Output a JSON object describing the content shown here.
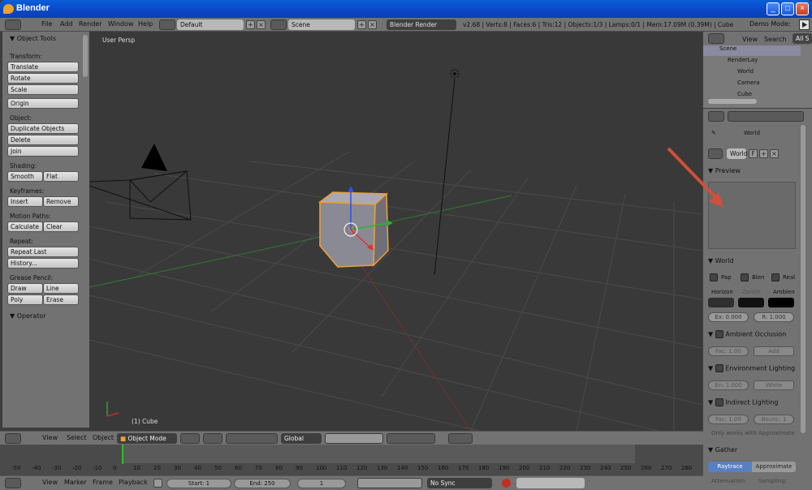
{
  "window": {
    "title": "Blender",
    "controls": [
      "_",
      "□",
      "×"
    ]
  },
  "infobar": {
    "menus": [
      "File",
      "Add",
      "Render",
      "Window",
      "Help"
    ],
    "layout": "Default",
    "scene": "Scene",
    "engine": "Blender Render",
    "stats": "v2.68 | Verts:8 | Faces:6 | Tris:12 | Objects:1/3 | Lamps:0/1 | Mem:17.09M (0.39M) | Cube",
    "demo_label": "Demo Mode:"
  },
  "toolshelf": {
    "title": "Object Tools",
    "sections": {
      "transform": "Transform:",
      "object": "Object:",
      "shading": "Shading:",
      "keyframes": "Keyframes:",
      "motion_paths": "Motion Paths:",
      "repeat": "Repeat:",
      "grease_pencil": "Grease Pencil:"
    },
    "buttons": {
      "translate": "Translate",
      "rotate": "Rotate",
      "scale": "Scale",
      "origin": "Origin",
      "duplicate": "Duplicate Objects",
      "delete": "Delete",
      "join": "Join",
      "smooth": "Smooth",
      "flat": "Flat",
      "insert": "Insert",
      "remove": "Remove",
      "calculate": "Calculate",
      "clear": "Clear",
      "repeat_last": "Repeat Last",
      "history": "History...",
      "draw": "Draw",
      "line": "Line",
      "poly": "Poly",
      "erase": "Erase"
    },
    "operator": "Operator"
  },
  "viewport": {
    "view_label": "User Persp",
    "object_label": "(1) Cube"
  },
  "viewport_header": {
    "menus": [
      "View",
      "Select",
      "Object"
    ],
    "mode": "Object Mode",
    "orientation": "Global"
  },
  "outliner": {
    "menus": [
      "View",
      "Search"
    ],
    "filter": "All S",
    "items": [
      "Scene",
      "RenderLay",
      "World",
      "Camera",
      "Cube"
    ]
  },
  "properties": {
    "breadcrumb": "World",
    "world_name": "World",
    "world_flag": "F",
    "preview_title": "Preview",
    "world_panel": "World",
    "checks": [
      "Pap",
      "Blen",
      "Real"
    ],
    "colors": {
      "labels": [
        "Horizon",
        "Zenith",
        "Ambien"
      ],
      "horizon": "#2f2f2f",
      "zenith": "#111111",
      "ambient": "#000000"
    },
    "exposure": "Ex: 0.000",
    "range": "R: 1.000",
    "ao": {
      "title": "Ambient Occlusion",
      "factor": "Fac: 1.00",
      "blend": "Add"
    },
    "env": {
      "title": "Environment Lighting",
      "energy": "En: 1.000",
      "color": "White"
    },
    "indirect": {
      "title": "Indirect Lighting",
      "factor": "Fac: 1.00",
      "bounces": "Bounc: 1",
      "note": "Only works with Approximate"
    },
    "gather": {
      "title": "Gather",
      "raytrace": "Raytrace",
      "approximate": "Approximate",
      "attenuation": "Attenuation:",
      "sampling": "Sampling:"
    }
  },
  "timeline": {
    "ticks": [
      "-50",
      "-40",
      "-30",
      "-20",
      "-10",
      "0",
      "10",
      "20",
      "30",
      "40",
      "50",
      "60",
      "70",
      "80",
      "90",
      "100",
      "110",
      "120",
      "130",
      "140",
      "150",
      "160",
      "170",
      "180",
      "190",
      "200",
      "210",
      "220",
      "230",
      "240",
      "250",
      "260",
      "270",
      "280"
    ],
    "menus": [
      "View",
      "Marker",
      "Frame",
      "Playback"
    ],
    "start": "Start: 1",
    "end": "End: 250",
    "current": "1",
    "sync": "No Sync"
  },
  "colors": {
    "accent_arrow": "#d0503a",
    "selection": "#f0a030",
    "panel": "#727272",
    "viewport": "#393939"
  }
}
